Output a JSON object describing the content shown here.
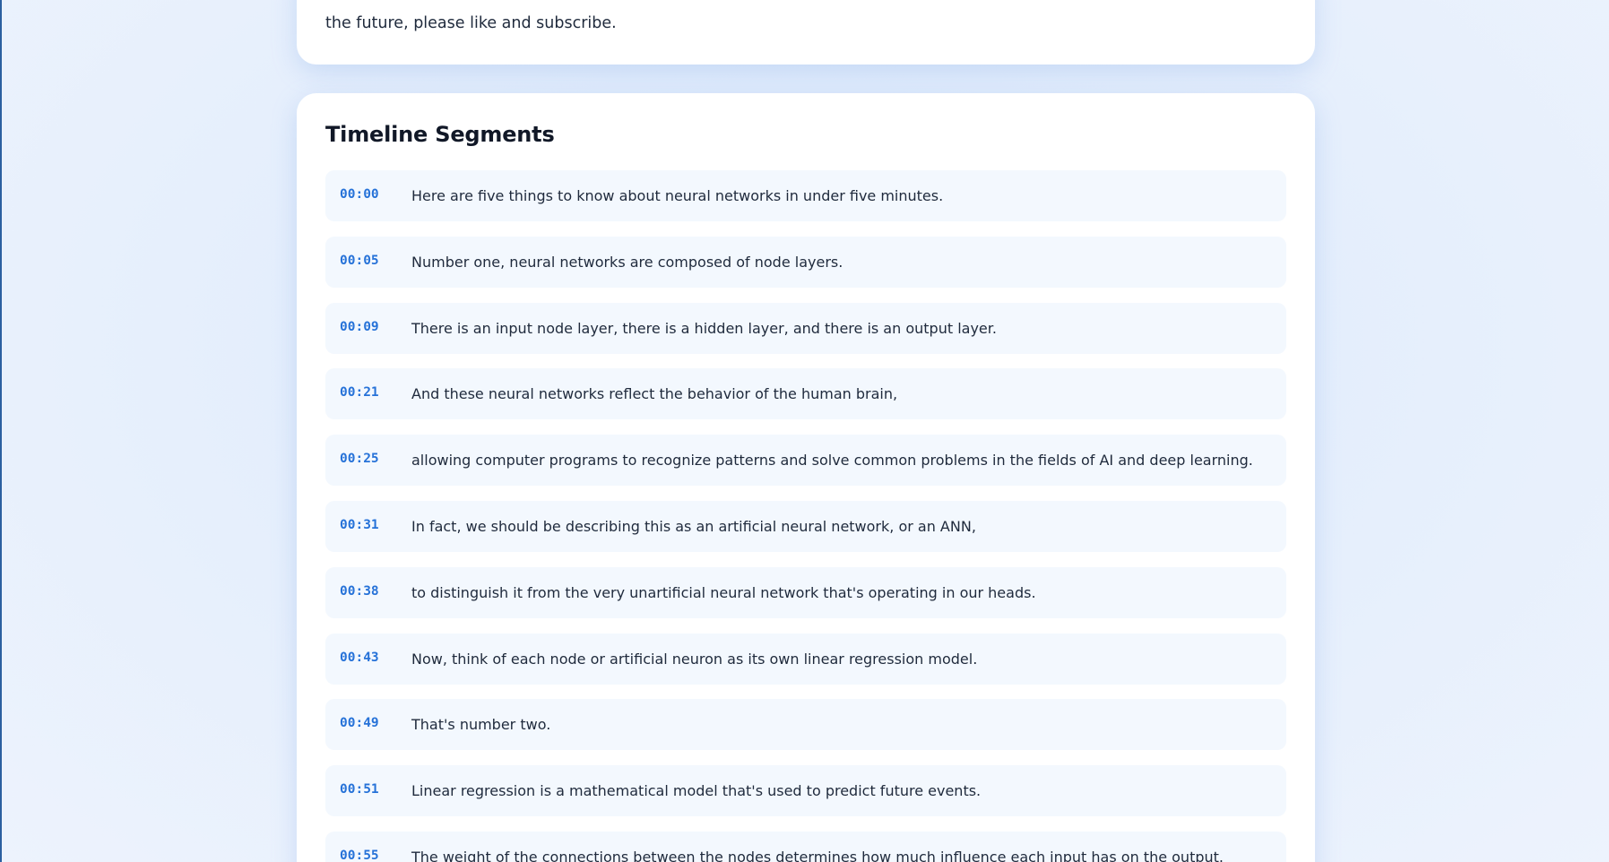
{
  "description": {
    "visible_line": "the future, please like and subscribe."
  },
  "timeline": {
    "title": "Timeline Segments",
    "segments": [
      {
        "time": "00:00",
        "text": "Here are five things to know about neural networks in under five minutes."
      },
      {
        "time": "00:05",
        "text": "Number one, neural networks are composed of node layers."
      },
      {
        "time": "00:09",
        "text": "There is an input node layer, there is a hidden layer, and there is an output layer."
      },
      {
        "time": "00:21",
        "text": "And these neural networks reflect the behavior of the human brain,"
      },
      {
        "time": "00:25",
        "text": "allowing computer programs to recognize patterns and solve common problems in the fields of AI and deep learning."
      },
      {
        "time": "00:31",
        "text": "In fact, we should be describing this as an artificial neural network, or an ANN,"
      },
      {
        "time": "00:38",
        "text": "to distinguish it from the very unartificial neural network that's operating in our heads."
      },
      {
        "time": "00:43",
        "text": "Now, think of each node or artificial neuron as its own linear regression model."
      },
      {
        "time": "00:49",
        "text": "That's number two."
      },
      {
        "time": "00:51",
        "text": "Linear regression is a mathematical model that's used to predict future events."
      },
      {
        "time": "00:55",
        "text": "The weight of the connections between the nodes determines how much influence each input has on the output."
      }
    ]
  }
}
